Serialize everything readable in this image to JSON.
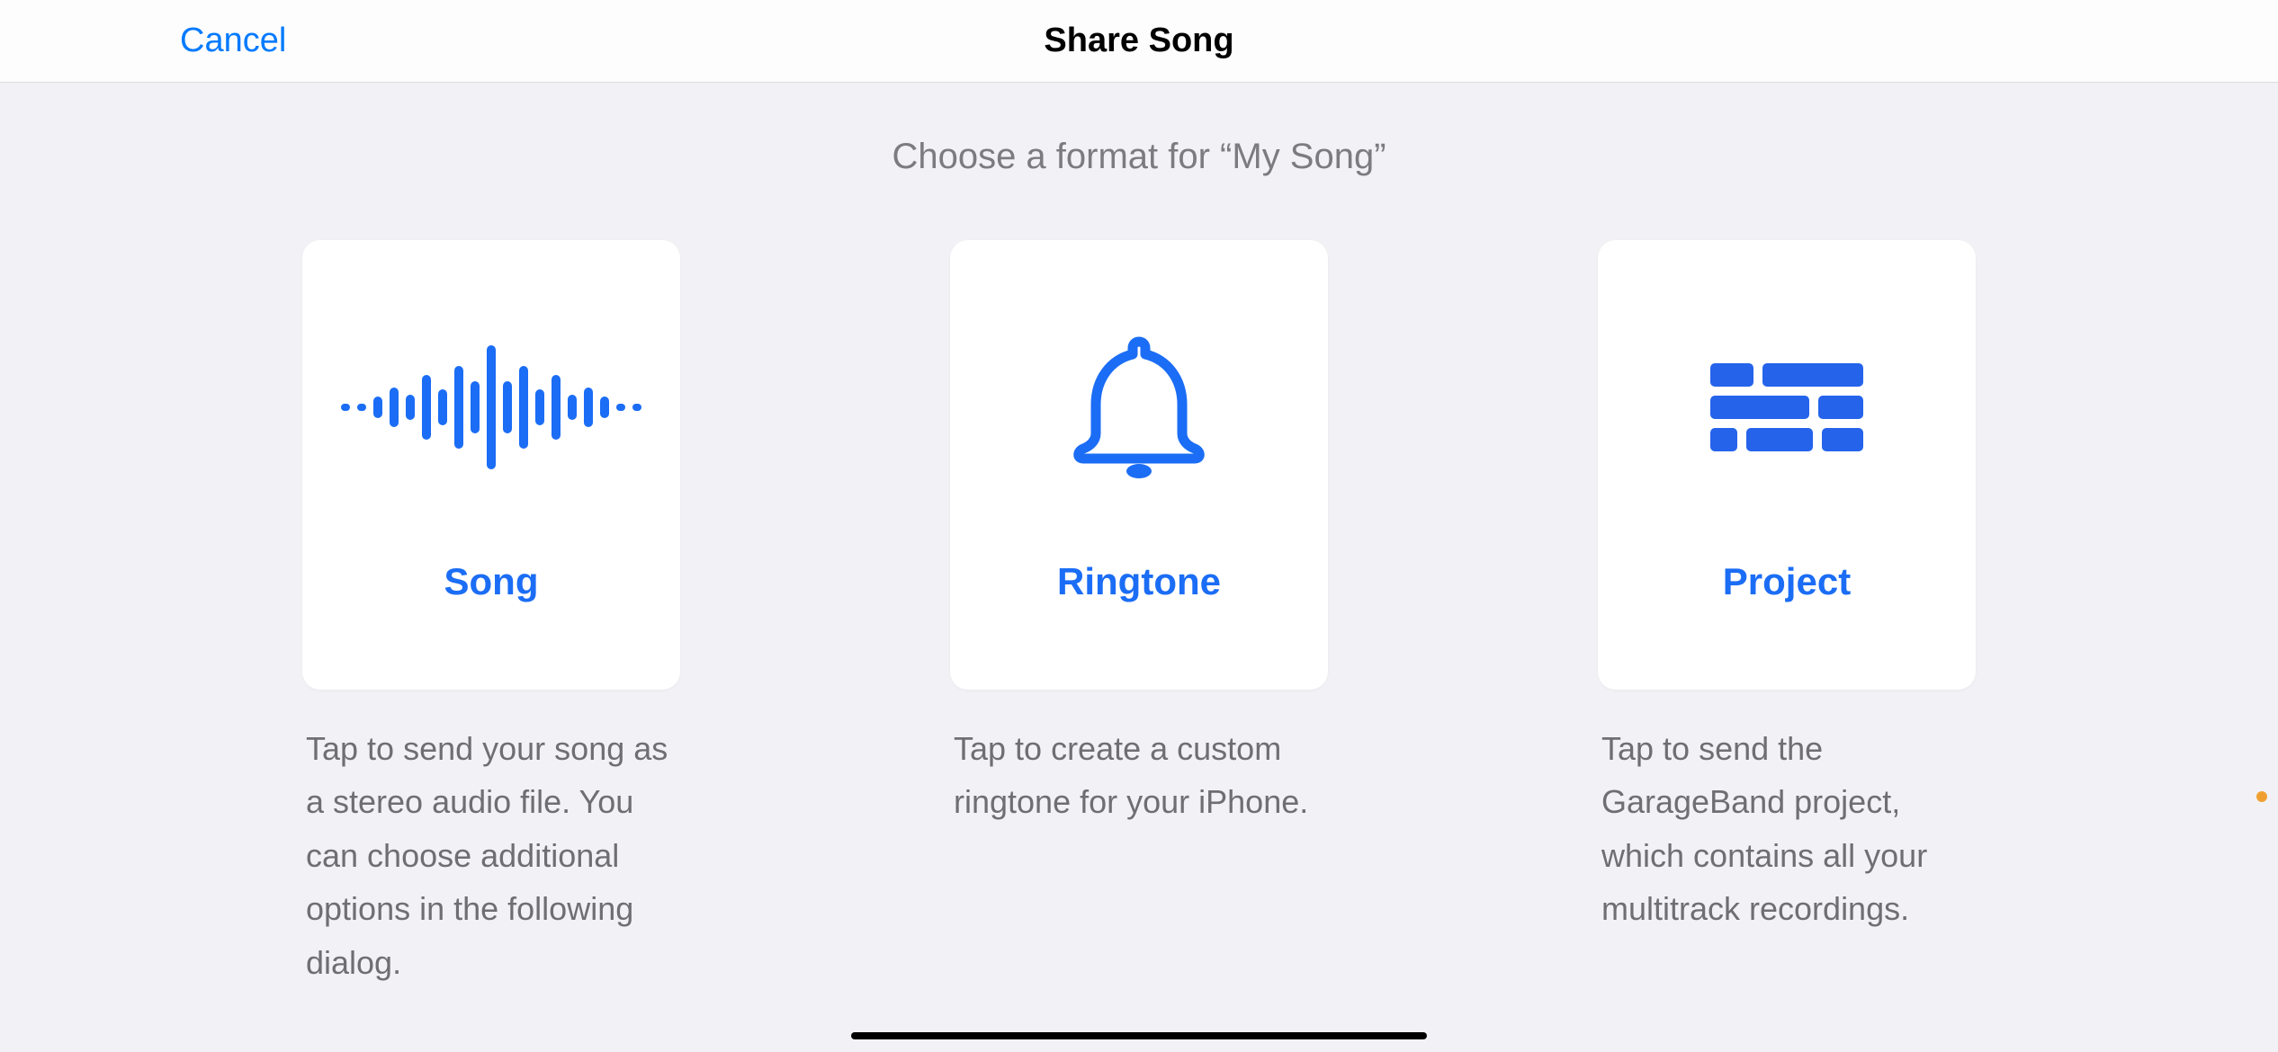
{
  "navbar": {
    "cancel_label": "Cancel",
    "title": "Share Song"
  },
  "subtitle": "Choose a format for “My Song”",
  "options": {
    "song": {
      "label": "Song",
      "description": "Tap to send your song as a stereo audio file. You can choose additional options in the following dialog.",
      "icon": "waveform-icon"
    },
    "ringtone": {
      "label": "Ringtone",
      "description": "Tap to create a custom ringtone for your iPhone.",
      "icon": "bell-icon"
    },
    "project": {
      "label": "Project",
      "description": "Tap to send the GarageBand project, which contains all your multitrack recordings.",
      "icon": "tracks-icon"
    }
  },
  "colors": {
    "accent": "#1b6df5",
    "link": "#007aff",
    "background": "#f2f2f6",
    "card": "#ffffff",
    "text_secondary": "#6e6e73"
  }
}
